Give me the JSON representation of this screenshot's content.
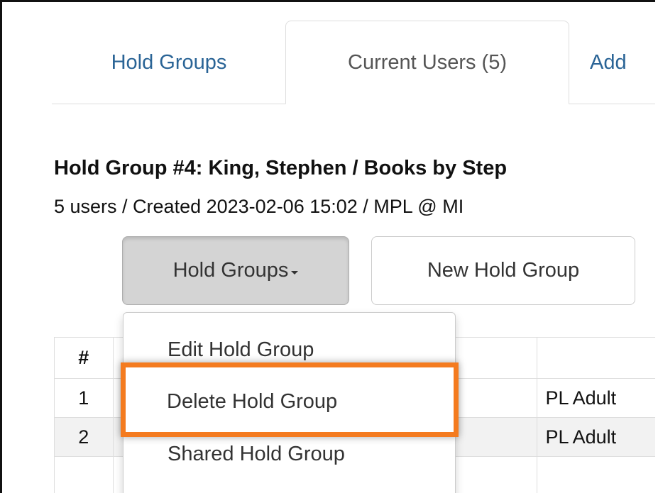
{
  "tabs": [
    {
      "label": "Hold Groups"
    },
    {
      "label": "Current Users (5)"
    },
    {
      "label": "Add"
    }
  ],
  "group": {
    "title": "Hold Group #4: King, Stephen / Books by Step",
    "meta": "5 users / Created 2023-02-06 15:02 / MPL @ MI"
  },
  "buttons": {
    "hold_groups": "Hold Groups",
    "new_hold_group": "New Hold Group"
  },
  "dropdown": {
    "items": [
      "Edit Hold Group",
      "Delete Hold Group",
      "Shared Hold Group"
    ]
  },
  "table": {
    "header": [
      "#",
      "",
      ""
    ],
    "rows": [
      {
        "num": "1",
        "lib": "PL Adult"
      },
      {
        "num": "2",
        "lib": "PL Adult"
      }
    ]
  },
  "colors": {
    "highlight": "#f47b1f",
    "link": "#2a6496"
  }
}
